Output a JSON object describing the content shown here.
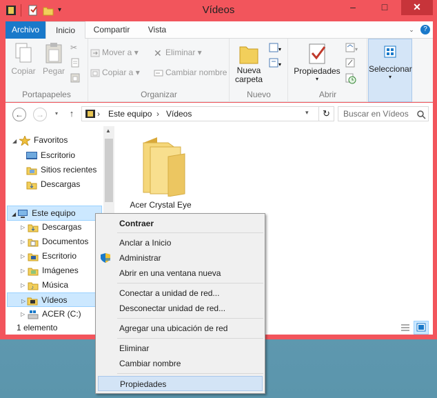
{
  "window": {
    "title": "Vídeos",
    "controls": {
      "minimize": "–",
      "maximize": "□",
      "close": "✕"
    }
  },
  "ribbon": {
    "tabs": [
      "Archivo",
      "Inicio",
      "Compartir",
      "Vista"
    ],
    "active_tab": "Inicio",
    "groups": {
      "portapapeles": {
        "label": "Portapapeles",
        "copiar": "Copiar",
        "pegar": "Pegar"
      },
      "organizar": {
        "label": "Organizar",
        "mover_a": "Mover a",
        "copiar_a": "Copiar a",
        "eliminar": "Eliminar",
        "cambiar_nombre": "Cambiar nombre"
      },
      "nuevo": {
        "label": "Nuevo",
        "nueva_carpeta_1": "Nueva",
        "nueva_carpeta_2": "carpeta"
      },
      "abrir": {
        "label": "Abrir",
        "propiedades": "Propiedades"
      },
      "seleccionar": {
        "label": "Seleccionar"
      }
    }
  },
  "address_bar": {
    "crumbs": [
      "Este equipo",
      "Vídeos"
    ],
    "search_placeholder": "Buscar en Vídeos"
  },
  "nav_pane": {
    "favoritos": "Favoritos",
    "fav_items": [
      "Escritorio",
      "Sitios recientes",
      "Descargas"
    ],
    "este_equipo": "Este equipo",
    "equipo_items": [
      "Descargas",
      "Documentos",
      "Escritorio",
      "Imágenes",
      "Música",
      "Vídeos",
      "ACER (C:)"
    ]
  },
  "content": {
    "folders": [
      "Acer Crystal Eye"
    ]
  },
  "status": {
    "count": "1 elemento"
  },
  "context_menu": {
    "items": [
      "Contraer",
      "Anclar a Inicio",
      "Administrar",
      "Abrir en una ventana nueva",
      "Conectar a unidad de red...",
      "Desconectar unidad de red...",
      "Agregar una ubicación de red",
      "Eliminar",
      "Cambiar nombre",
      "Propiedades"
    ],
    "highlighted": "Propiedades"
  },
  "colors": {
    "frame": "#f2555c",
    "accent": "#1979ca",
    "selection": "#cce8ff"
  }
}
